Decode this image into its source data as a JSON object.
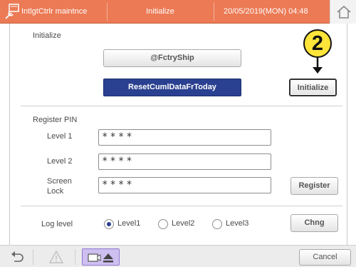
{
  "header": {
    "app_title": "IntlgtCtrlr maintnce",
    "screen_title": "Initialize",
    "datetime": "20/05/2019(MON) 04:48"
  },
  "initialize": {
    "section_label": "Initialize",
    "factory_ship_label": "@FctryShip",
    "reset_cumul_label": "ResetCumlDataFrToday",
    "initialize_button_label": "Initialize"
  },
  "callout": {
    "number": "2"
  },
  "register_pin": {
    "section_label": "Register PIN",
    "fields": [
      {
        "label": "Level 1",
        "value": "****"
      },
      {
        "label": "Level 2",
        "value": "****"
      },
      {
        "label_line1": "Screen",
        "label_line2": "Lock",
        "value": "****"
      }
    ],
    "register_button_label": "Register"
  },
  "log_level": {
    "label": "Log level",
    "options": [
      {
        "label": "Level1",
        "selected": true
      },
      {
        "label": "Level2",
        "selected": false
      },
      {
        "label": "Level3",
        "selected": false
      }
    ],
    "change_button_label": "Chng"
  },
  "footer": {
    "cancel_label": "Cancel",
    "icons": [
      "back-arrow-icon",
      "warning-icon",
      "media-eject-icon"
    ]
  },
  "colors": {
    "header": "#eb7a55",
    "primary_button": "#2a4090",
    "callout": "#ffe43a"
  }
}
